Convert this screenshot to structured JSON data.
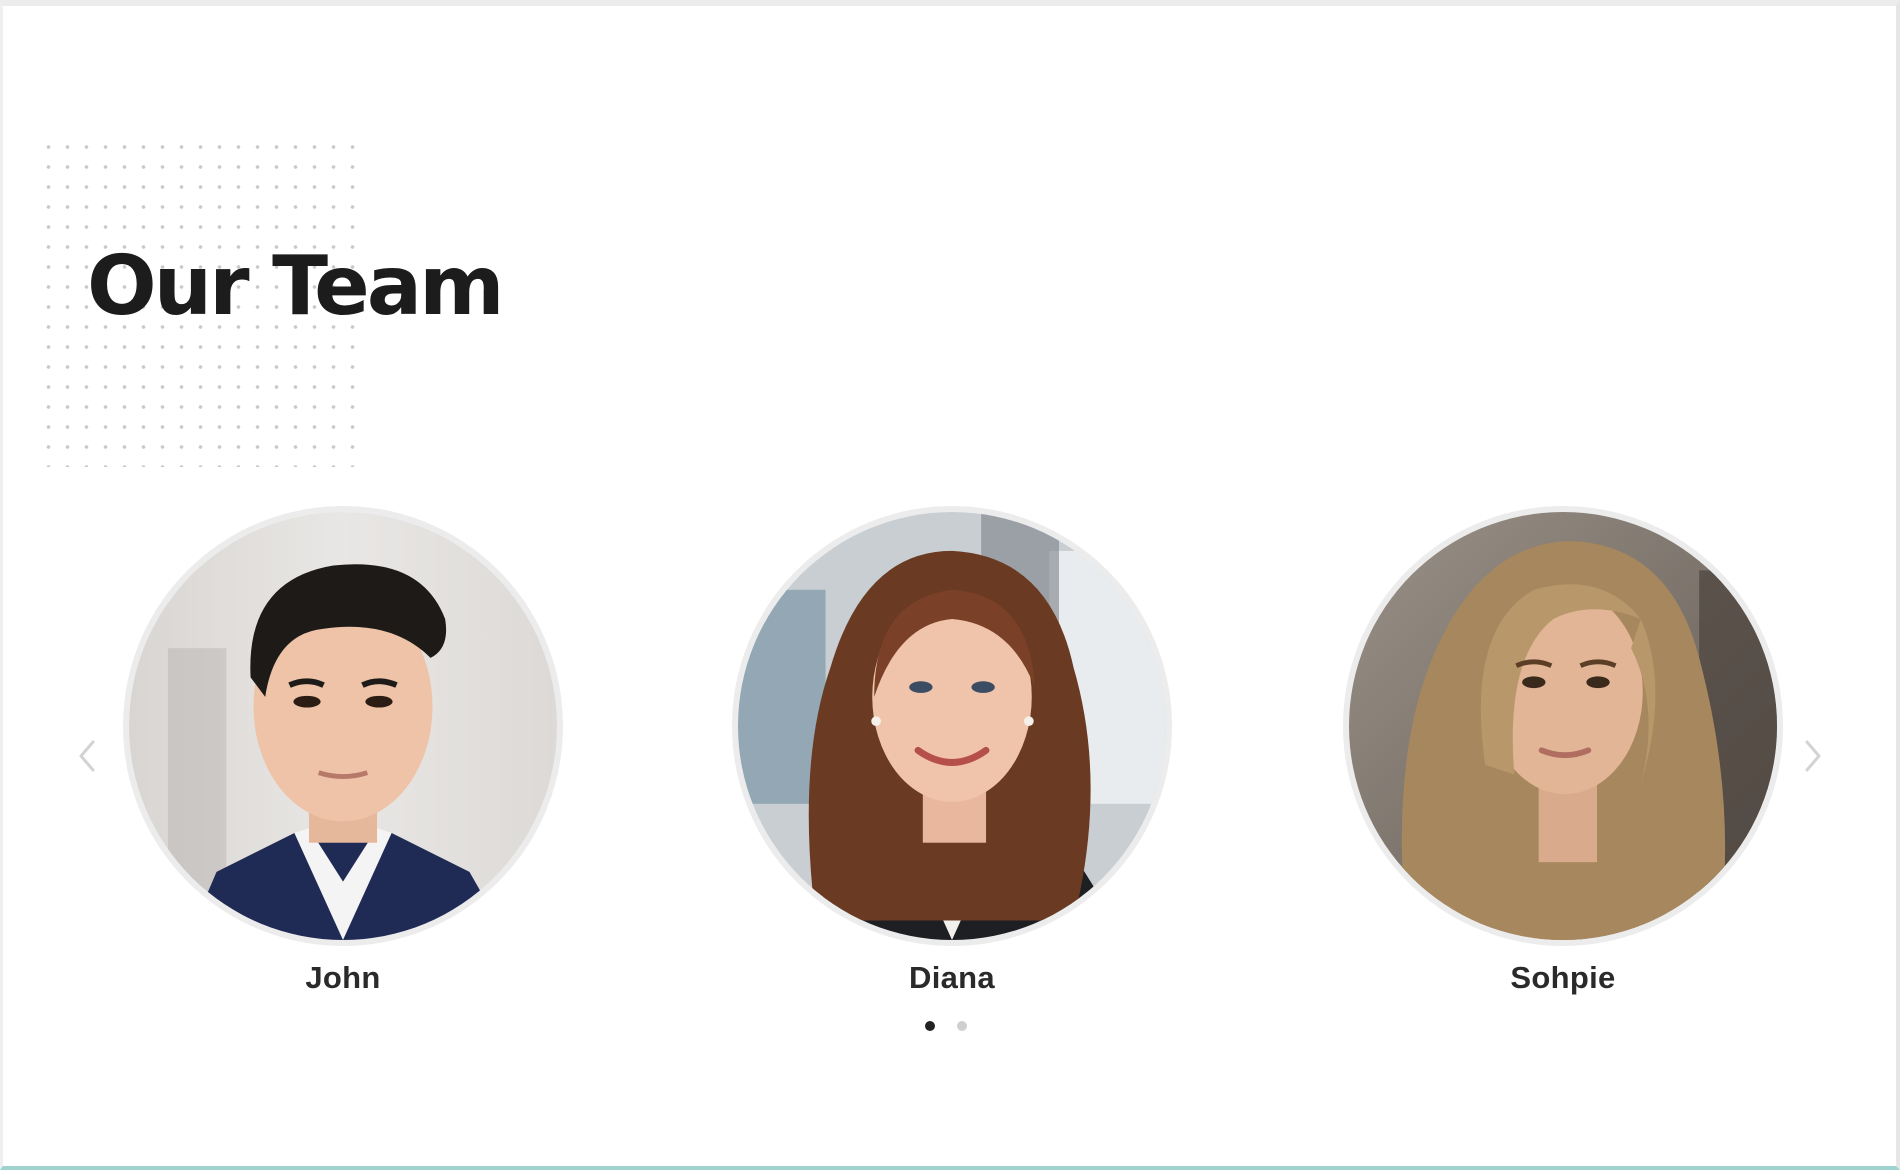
{
  "section": {
    "title": "Our Team"
  },
  "team": {
    "members": [
      {
        "name": "John"
      },
      {
        "name": "Diana"
      },
      {
        "name": "Sohpie"
      }
    ]
  },
  "carousel": {
    "prev_icon": "chevron-left-icon",
    "next_icon": "chevron-right-icon",
    "page_count": 2,
    "active_page": 1
  },
  "colors": {
    "title": "#1c1c1c",
    "name": "#2a2a2a",
    "arrow": "#d3d3d3",
    "dot_active": "#222222",
    "dot_inactive": "#cfcfcf",
    "bottom_border": "#9ed3cf"
  }
}
